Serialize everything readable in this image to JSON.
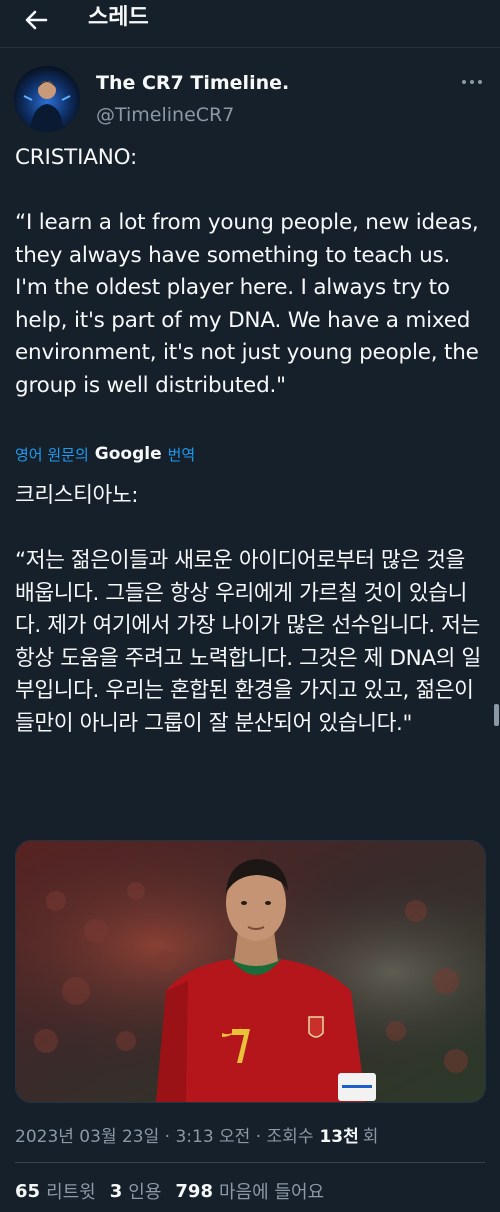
{
  "topbar": {
    "title": "스레드",
    "back_icon": "arrow-left-icon"
  },
  "author": {
    "display_name": "The CR7 Timeline.",
    "handle": "@TimelineCR7",
    "more_icon": "more-horizontal-icon"
  },
  "tweet": {
    "text": "CRISTIANO:\n\n“I learn a lot from young people, new ideas, they always have something to teach us. I'm the oldest player here. I always try to help, it's part of my DNA. We have a mixed environment, it's not just young people, the group is well distributed.\"",
    "translation_prefix": "영어 원문의",
    "translation_brand": "Google",
    "translation_suffix": "번역",
    "translated_text": "크리스티아노:\n\n“저는 젊은이들과 새로운 아이디어로부터 많은 것을 배웁니다. 그들은 항상 우리에게 가르칠 것이 있습니다. 제가 여기에서 가장 나이가 많은 선수입니다. 저는 항상 도움을 주려고 노력합니다. 그것은 제 DNA의 일부입니다. 우리는 혼합된 환경을 가지고 있고, 젊은이들만이 아니라 그룹이 잘 분산되어 있습니다.\""
  },
  "meta": {
    "timestamp": "2023년 03월 23일 · 3:13 오전 · 조회수",
    "views_count": "13천",
    "views_suffix": "회"
  },
  "stats": {
    "retweets": "65",
    "retweets_label": "리트윗",
    "quotes": "3",
    "quotes_label": "인용",
    "likes": "798",
    "likes_label": "마음에 들어요"
  },
  "colors": {
    "background": "#15202b",
    "text": "#f7f9f9",
    "secondary": "#8b98a5",
    "accent": "#1d9bf0"
  }
}
